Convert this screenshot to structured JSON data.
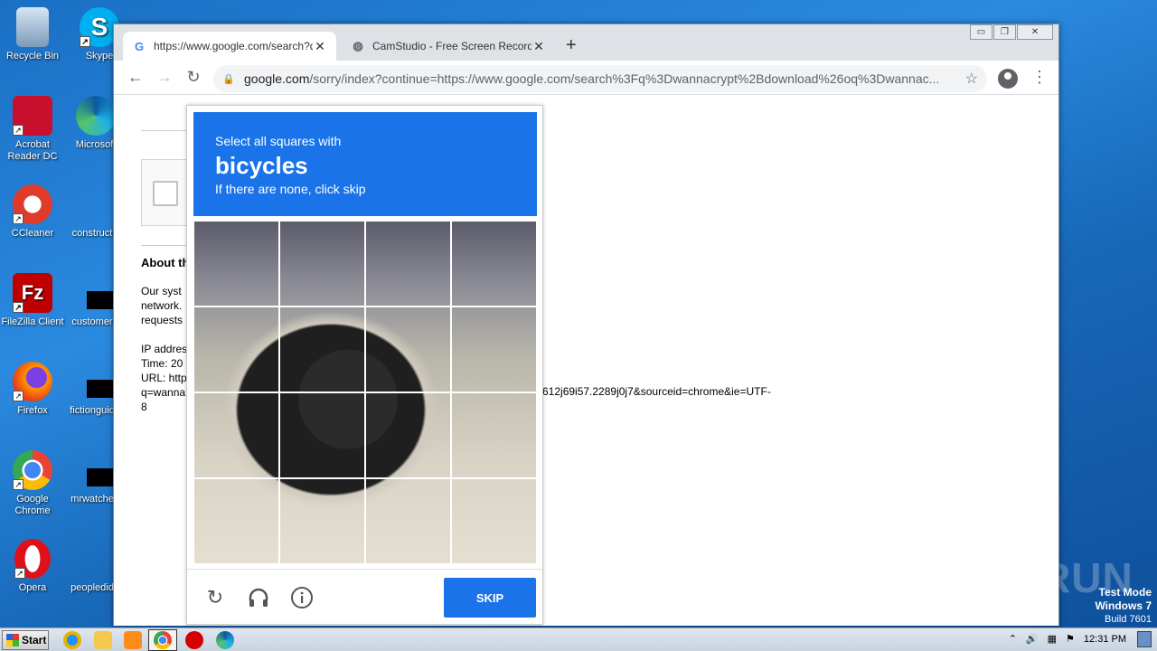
{
  "desktop": {
    "icons": [
      {
        "label": "Recycle Bin"
      },
      {
        "label": "Skype"
      },
      {
        "label": "Acrobat Reader DC"
      },
      {
        "label": "Microsoft"
      },
      {
        "label": "CCleaner"
      },
      {
        "label": "construct"
      },
      {
        "label": "FileZilla Client"
      },
      {
        "label": "customer"
      },
      {
        "label": "Firefox"
      },
      {
        "label": "fictionguid"
      },
      {
        "label": "Google Chrome"
      },
      {
        "label": "mrwatche"
      },
      {
        "label": "Opera"
      },
      {
        "label": "peopledid"
      }
    ]
  },
  "browser": {
    "tabs": [
      {
        "title": "https://www.google.com/search?q=",
        "close": "✕"
      },
      {
        "title": "CamStudio - Free Screen Recording",
        "close": "✕"
      }
    ],
    "new_tab": "+",
    "window_controls": {
      "minimize": "▭",
      "restore": "❐",
      "close": "✕"
    },
    "address": {
      "host": "google.com",
      "path": "/sorry/index?continue=https://www.google.com/search%3Fq%3Dwannacrypt%2Bdownload%26oq%3Dwannac..."
    }
  },
  "page": {
    "about_heading": "About th",
    "para_lines": [
      "Our syst",
      "network.",
      "requests"
    ],
    "ip_lines": [
      "IP addres",
      "Time: 20",
      "URL: http",
      "q=wanna",
      "8"
    ],
    "url_tail": "612j69i57.2289j0j7&sourceid=chrome&ie=UTF-"
  },
  "captcha": {
    "instruction": "Select all squares with",
    "target": "bicycles",
    "hint": "If there are none, click skip",
    "skip_label": "SKIP"
  },
  "taskbar": {
    "start_label": "Start",
    "clock": "12:31 PM"
  },
  "watermark": {
    "text": "ANY RUN",
    "test_mode": "Test Mode",
    "os": "Windows 7",
    "build": "Build 7601"
  }
}
